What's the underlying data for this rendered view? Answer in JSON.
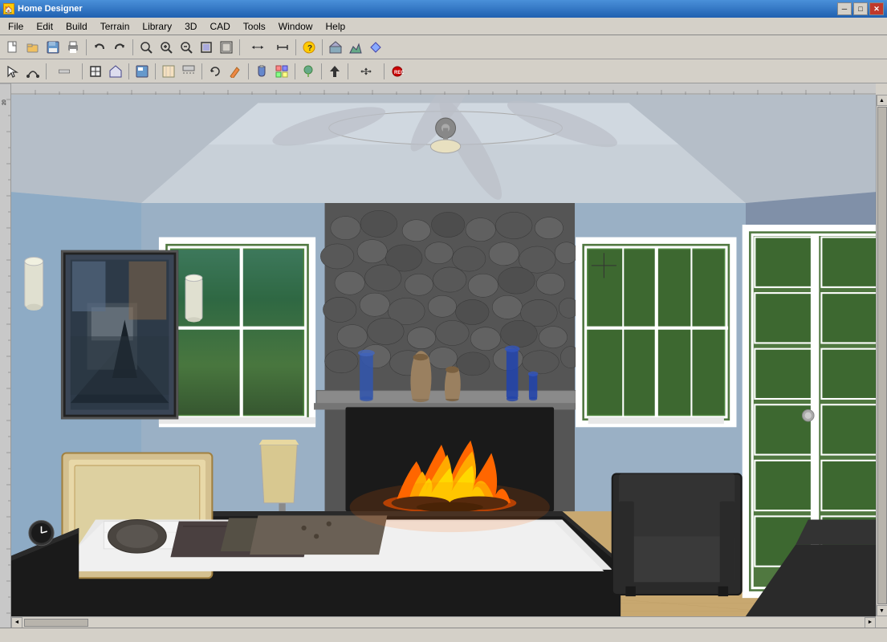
{
  "app": {
    "title": "Home Designer",
    "icon": "🏠"
  },
  "titlebar": {
    "minimize_label": "─",
    "maximize_label": "□",
    "close_label": "✕"
  },
  "menubar": {
    "items": [
      {
        "label": "File",
        "id": "file"
      },
      {
        "label": "Edit",
        "id": "edit"
      },
      {
        "label": "Build",
        "id": "build"
      },
      {
        "label": "Terrain",
        "id": "terrain"
      },
      {
        "label": "Library",
        "id": "library"
      },
      {
        "label": "3D",
        "id": "3d"
      },
      {
        "label": "CAD",
        "id": "cad"
      },
      {
        "label": "Tools",
        "id": "tools"
      },
      {
        "label": "Window",
        "id": "window"
      },
      {
        "label": "Help",
        "id": "help"
      }
    ]
  },
  "toolbar1": {
    "buttons": [
      {
        "icon": "📄",
        "title": "New",
        "id": "new"
      },
      {
        "icon": "📂",
        "title": "Open",
        "id": "open"
      },
      {
        "icon": "💾",
        "title": "Save",
        "id": "save"
      },
      {
        "icon": "🖨",
        "title": "Print",
        "id": "print"
      },
      {
        "icon": "↩",
        "title": "Undo",
        "id": "undo"
      },
      {
        "icon": "↪",
        "title": "Redo",
        "id": "redo"
      },
      {
        "icon": "🔍",
        "title": "Zoom",
        "id": "zoom"
      },
      {
        "icon": "🔎",
        "title": "Zoom In",
        "id": "zoom-in"
      },
      {
        "icon": "🔍",
        "title": "Zoom Out",
        "id": "zoom-out"
      },
      {
        "icon": "⊞",
        "title": "Fit",
        "id": "fit"
      },
      {
        "icon": "⊡",
        "title": "Fit All",
        "id": "fit-all"
      },
      {
        "icon": "↕",
        "title": "Pan",
        "id": "pan"
      },
      {
        "icon": "📐",
        "title": "Measure",
        "id": "measure"
      },
      {
        "icon": "❓",
        "title": "Help",
        "id": "help-btn"
      },
      {
        "icon": "🏠",
        "title": "Home",
        "id": "home"
      },
      {
        "icon": "🏔",
        "title": "Exterior",
        "id": "exterior"
      },
      {
        "icon": "🏘",
        "title": "Interior",
        "id": "interior"
      }
    ]
  },
  "toolbar2": {
    "buttons": [
      {
        "icon": "↖",
        "title": "Select",
        "id": "select"
      },
      {
        "icon": "〰",
        "title": "Draw Line",
        "id": "draw-line"
      },
      {
        "icon": "━",
        "title": "Wall",
        "id": "wall"
      },
      {
        "icon": "▦",
        "title": "Room",
        "id": "room"
      },
      {
        "icon": "🏠",
        "title": "House",
        "id": "house"
      },
      {
        "icon": "💾",
        "title": "Save View",
        "id": "save-view"
      },
      {
        "icon": "🔲",
        "title": "Floor",
        "id": "floor"
      },
      {
        "icon": "🔳",
        "title": "Ceiling",
        "id": "ceiling"
      },
      {
        "icon": "🔁",
        "title": "Rotate",
        "id": "rotate"
      },
      {
        "icon": "✏",
        "title": "Edit",
        "id": "edit-tool"
      },
      {
        "icon": "🎨",
        "title": "Paint",
        "id": "paint"
      },
      {
        "icon": "🔧",
        "title": "Material",
        "id": "material"
      },
      {
        "icon": "⊕",
        "title": "Add",
        "id": "add"
      },
      {
        "icon": "↑",
        "title": "Up",
        "id": "up"
      },
      {
        "icon": "↔",
        "title": "Move",
        "id": "move"
      },
      {
        "icon": "⏺",
        "title": "Record",
        "id": "record"
      }
    ]
  },
  "scene": {
    "description": "3D bedroom interior view with fireplace, bed, and windows"
  },
  "statusbar": {
    "text": ""
  }
}
